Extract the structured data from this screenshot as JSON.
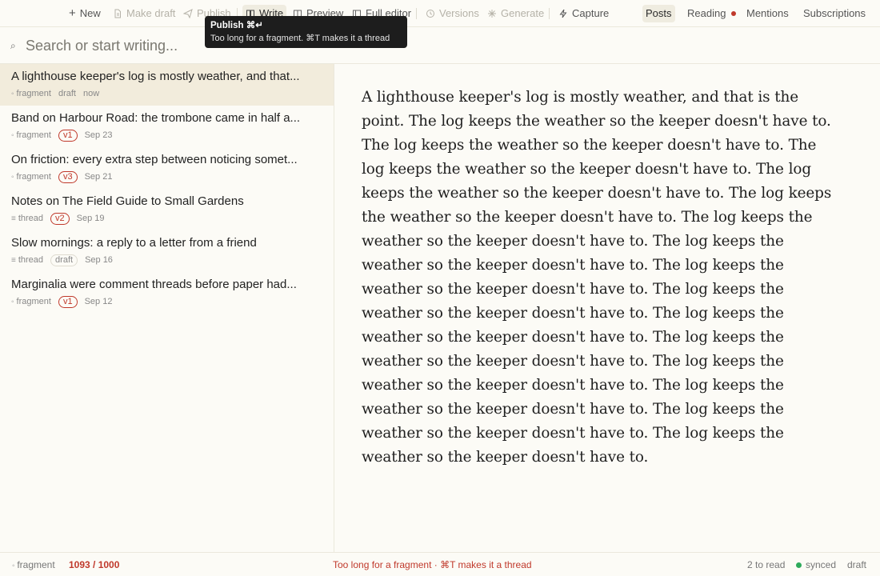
{
  "toolbar": {
    "new_label": "New",
    "make_draft_label": "Make draft",
    "publish_label": "Publish",
    "write_label": "Write",
    "preview_label": "Preview",
    "full_editor_label": "Full editor",
    "versions_label": "Versions",
    "generate_label": "Generate",
    "capture_label": "Capture",
    "tabs": [
      {
        "label": "Posts",
        "active": true
      },
      {
        "label": "Reading",
        "active": false,
        "unread_dot": true
      },
      {
        "label": "Mentions",
        "active": false
      },
      {
        "label": "Subscriptions",
        "active": false
      }
    ]
  },
  "tooltip": {
    "title": "Publish ⌘↵",
    "subtitle": "Too long for a fragment. ⌘T makes it a thread"
  },
  "search": {
    "placeholder": "Search or start writing..."
  },
  "posts": [
    {
      "title": "A lighthouse keeper's log is mostly weather, and that...",
      "kind": "fragment",
      "status": "draft",
      "date": "now",
      "selected": true
    },
    {
      "title": "Band on Harbour Road: the trombone came in half a...",
      "kind": "fragment",
      "version": "v1",
      "date": "Sep 23"
    },
    {
      "title": "On friction: every extra step between noticing somet...",
      "kind": "fragment",
      "version": "v3",
      "date": "Sep 21"
    },
    {
      "title": "Notes on The Field Guide to Small Gardens",
      "kind": "thread",
      "version": "v2",
      "date": "Sep 19"
    },
    {
      "title": "Slow mornings: a reply to a letter from a friend",
      "kind": "thread",
      "status": "draft",
      "date": "Sep 16"
    },
    {
      "title": "Marginalia were comment threads before paper had...",
      "kind": "fragment",
      "version": "v1",
      "date": "Sep 12"
    }
  ],
  "editor": {
    "body": "A lighthouse keeper's log is mostly weather, and that is the point. The log keeps the weather so the keeper doesn't have to. The log keeps the weather so the keeper doesn't have to. The log keeps the weather so the keeper doesn't have to. The log keeps the weather so the keeper doesn't have to. The log keeps the weather so the keeper doesn't have to. The log keeps the weather so the keeper doesn't have to. The log keeps the weather so the keeper doesn't have to. The log keeps the weather so the keeper doesn't have to. The log keeps the weather so the keeper doesn't have to. The log keeps the weather so the keeper doesn't have to. The log keeps the weather so the keeper doesn't have to. The log keeps the weather so the keeper doesn't have to. The log keeps the weather so the keeper doesn't have to. The log keeps the weather so the keeper doesn't have to. The log keeps the weather so the keeper doesn't have to."
  },
  "statusbar": {
    "kind": "fragment",
    "count": "1093 / 1000",
    "warning": "Too long for a fragment · ⌘T makes it a thread",
    "to_read": "2 to read",
    "sync": "synced",
    "state": "draft"
  },
  "colors": {
    "background": "#fcfbf6",
    "selected_row": "#f2ecdc",
    "accent_red": "#c0392b",
    "synced_green": "#2eaa5b"
  }
}
